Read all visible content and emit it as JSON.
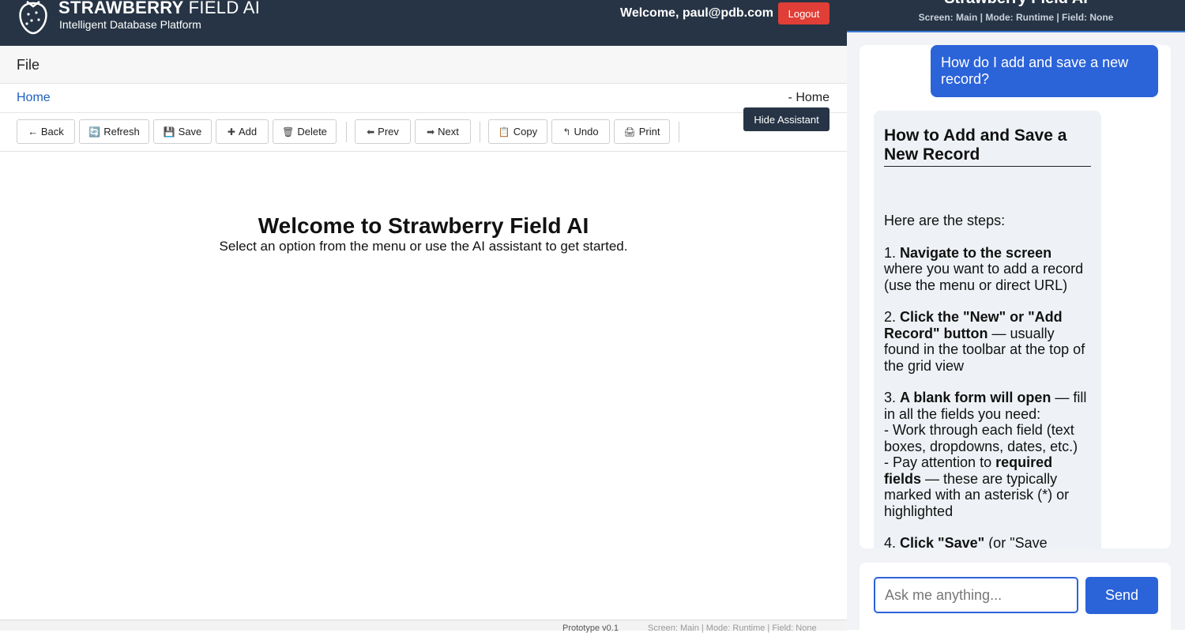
{
  "header": {
    "brand_title": "STRAWBERRY",
    "brand_title_light": "FIELD AI",
    "brand_subtitle": "Intelligent Database Platform",
    "welcome": "Welcome, paul@pdb.com",
    "logout_label": "Logout"
  },
  "menu": {
    "file_label": "File"
  },
  "breadcrumb": {
    "home": "Home",
    "right": "- Home"
  },
  "hide_assistant_label": "Hide Assistant",
  "toolbar": {
    "back": "← Back",
    "refresh": "Refresh",
    "save": "Save",
    "add": "Add",
    "delete": "Delete",
    "prev": "Prev",
    "next": "Next",
    "copy": "Copy",
    "undo": "Undo",
    "print": "Print"
  },
  "main": {
    "title": "Welcome to Strawberry Field AI",
    "subtitle": "Select an option from the menu or use the AI assistant to get started."
  },
  "footer": {
    "version": "Prototype v0.1",
    "status": "Screen: Main | Mode: Runtime | Field: None"
  },
  "assistant": {
    "title": "Strawberry Field AI",
    "status": "Screen: Main | Mode: Runtime | Field: None",
    "user_message": "How do I add and save a new record?",
    "bot": {
      "heading": "How to Add and Save a New Record",
      "intro": "Here are the steps:",
      "step1_num": "1.",
      "step1_bold": "Navigate to the screen",
      "step1_text": "where you want to add a record (use the menu or direct URL)",
      "step2_num": "2.",
      "step2_bold": "Click the \"New\" or \"Add Record\" button",
      "step2_text": "— usually found in the toolbar at the top of the grid view",
      "step3_num": "3.",
      "step3_bold": "A blank form will open",
      "step3_text": "— fill in all the fields you need:",
      "step3_sub1": "- Work through each field (text boxes, dropdowns, dates, etc.)",
      "step3_sub2_a": "- Pay attention to",
      "step3_sub2_bold": "required fields",
      "step3_sub2_b": "— these are typically marked with an asterisk (*) or highlighted",
      "step4_num": "4.",
      "step4_bold": "Click \"Save\"",
      "step4_text": "(or \"Save Record\") when you're done"
    },
    "input_placeholder": "Ask me anything...",
    "send_label": "Send"
  },
  "colors": {
    "header_bg": "#263445",
    "accent_blue": "#2b63d9",
    "logout_red": "#e03e36",
    "link_blue": "#1f5fbf"
  }
}
